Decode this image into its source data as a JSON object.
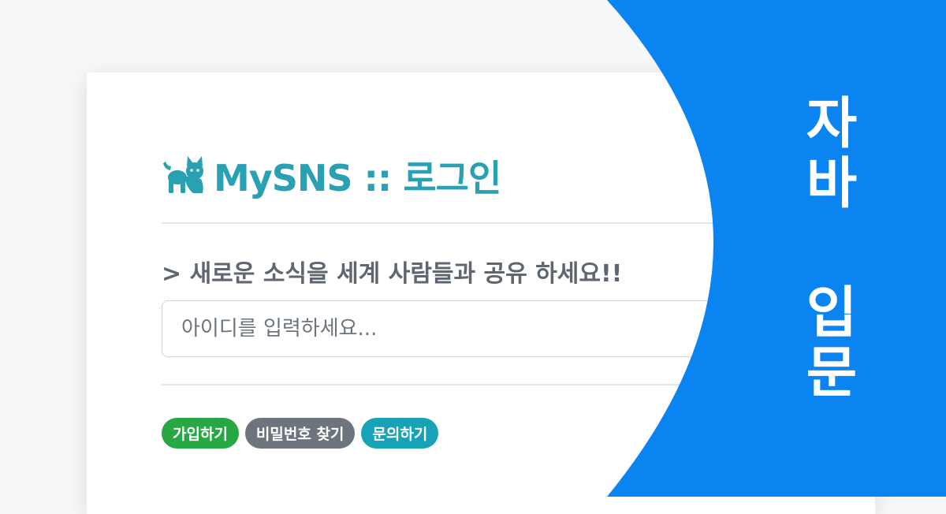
{
  "login_card": {
    "title": "MySNS :: 로그인",
    "subtitle": "> 새로운 소식을 세계 사람들과 공유 하세요!!",
    "id_input": {
      "value": "",
      "placeholder": "아이디를 입력하세요..."
    },
    "links": {
      "signup": "가입하기",
      "find_password": "비밀번호 찾기",
      "contact": "문의하기"
    }
  },
  "banner": {
    "title": "자바 입문"
  },
  "colors": {
    "brand_teal": "#2aa0b3",
    "banner_blue": "#0a84f0",
    "signup_badge": "#28a745",
    "password_badge": "#6c757d",
    "contact_badge": "#17a2b8"
  },
  "icons": {
    "logo": "cat-icon"
  }
}
